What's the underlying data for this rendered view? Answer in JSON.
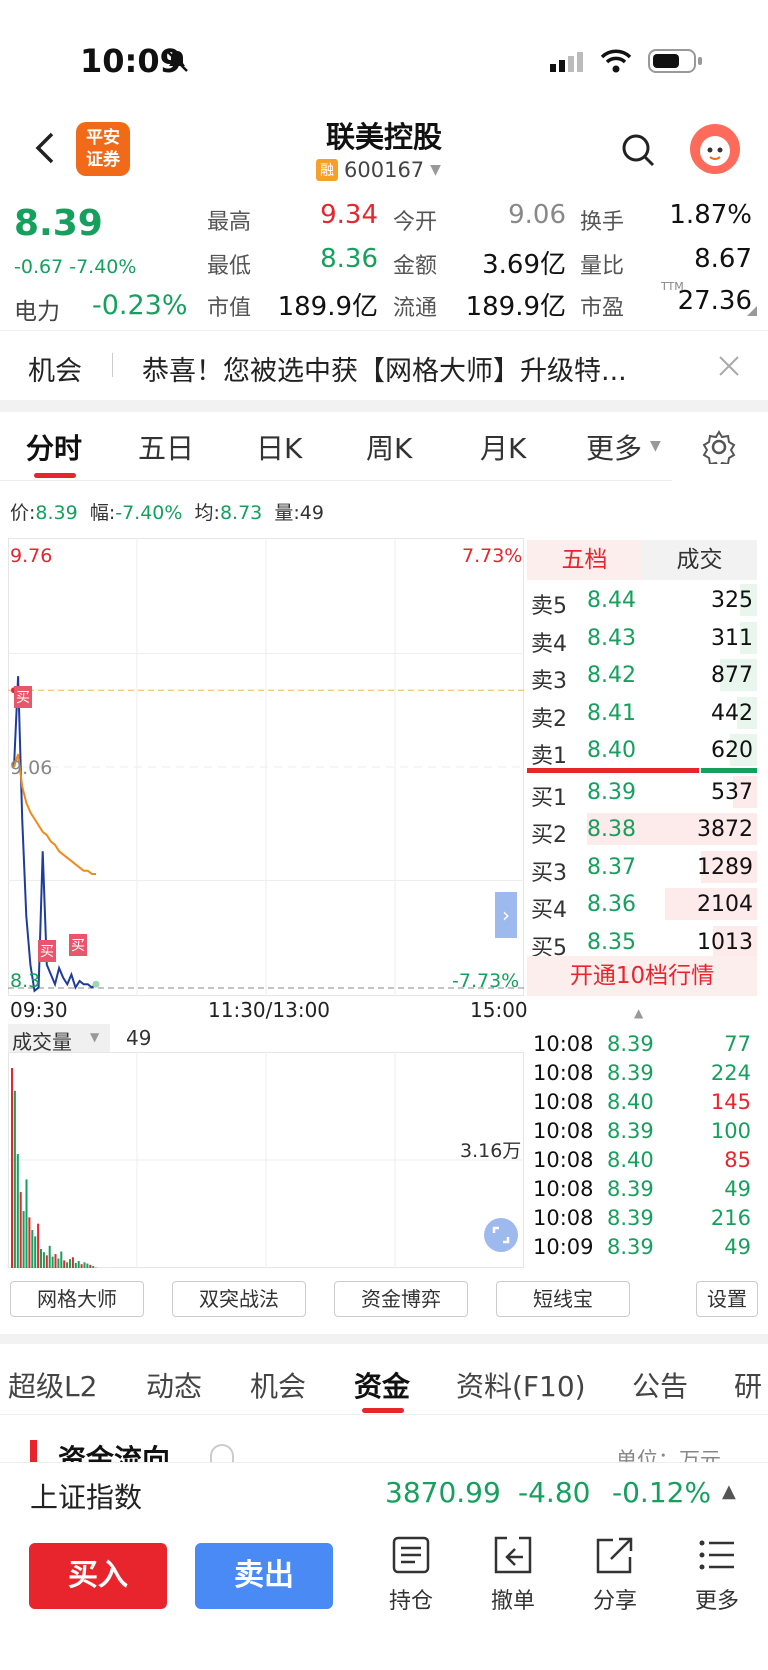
{
  "status": {
    "time": "10:09"
  },
  "header": {
    "title": "联美控股",
    "rong": "融",
    "code": "600167",
    "logo_line1": "平安",
    "logo_line2": "证券"
  },
  "quote": {
    "price": "8.39",
    "change": "-0.67",
    "change_pct": "-7.40%",
    "sector_label": "电力",
    "sector_value": "-0.23%",
    "fields": [
      {
        "label": "最高",
        "value": "9.34",
        "color": "red"
      },
      {
        "label": "今开",
        "value": "9.06",
        "color": "gray"
      },
      {
        "label": "换手",
        "value": "1.87%",
        "color": "dark"
      },
      {
        "label": "最低",
        "value": "8.36",
        "color": "green"
      },
      {
        "label": "金额",
        "value": "3.69亿",
        "color": "dark"
      },
      {
        "label": "量比",
        "value": "8.67",
        "color": "dark"
      },
      {
        "label": "市值",
        "value": "189.9亿",
        "color": "dark"
      },
      {
        "label": "流通",
        "value": "189.9亿",
        "color": "dark"
      },
      {
        "label": "市盈",
        "value": "27.36",
        "color": "dark"
      }
    ],
    "ttm": "TTM"
  },
  "notice": {
    "tag": "机会",
    "text": "恭喜！您被选中获【网格大师】升级特..."
  },
  "chart_tabs": [
    "分时",
    "五日",
    "日K",
    "周K",
    "月K",
    "更多"
  ],
  "info": {
    "price_label": "价:",
    "price": "8.39",
    "amp_label": "幅:",
    "amp": "-7.40%",
    "avg_label": "均:",
    "avg": "8.73",
    "vol_label": "量:",
    "vol": "49"
  },
  "chart_labels": {
    "top_price": "9.76",
    "top_pct": "7.73%",
    "mid_price": "9.06",
    "bottom_price": "8.3",
    "bottom_pct": "-7.73%",
    "t_start": "09:30",
    "t_mid": "11:30/13:00",
    "t_end": "15:00",
    "vol_title": "成交量",
    "vol_value": "49",
    "vol_max": "3.16万",
    "marker": "买"
  },
  "chart_data": {
    "type": "line",
    "ylim": [
      8.36,
      9.76
    ],
    "prev_close": 9.06,
    "series": [
      {
        "name": "价",
        "values": [
          9.06,
          9.34,
          8.9,
          8.6,
          8.45,
          8.37,
          8.38,
          8.8,
          8.45,
          8.42,
          8.39,
          8.44,
          8.41,
          8.39,
          8.42,
          8.38,
          8.4,
          8.39,
          8.39,
          8.38,
          8.39
        ]
      },
      {
        "name": "均",
        "values": [
          9.06,
          9.1,
          9.0,
          8.95,
          8.92,
          8.9,
          8.88,
          8.86,
          8.85,
          8.83,
          8.82,
          8.8,
          8.79,
          8.78,
          8.77,
          8.76,
          8.75,
          8.74,
          8.74,
          8.73,
          8.73
        ]
      }
    ],
    "volume": [
      31600,
      28000,
      18000,
      12000,
      9000,
      14000,
      8000,
      6000,
      5000,
      7000,
      3000,
      2500,
      2000,
      3500,
      1800,
      2200,
      1500,
      2600,
      1200,
      900,
      1400,
      1700,
      800,
      1100,
      600,
      900,
      700,
      500,
      300,
      49
    ]
  },
  "orderbook": {
    "tabs": [
      "五档",
      "成交"
    ],
    "asks": [
      {
        "label": "卖5",
        "price": "8.44",
        "qty": "325",
        "level": 0.1
      },
      {
        "label": "卖4",
        "price": "8.43",
        "qty": "311",
        "level": 0.1
      },
      {
        "label": "卖3",
        "price": "8.42",
        "qty": "877",
        "level": 0.22
      },
      {
        "label": "卖2",
        "price": "8.41",
        "qty": "442",
        "level": 0.12
      },
      {
        "label": "卖1",
        "price": "8.40",
        "qty": "620",
        "level": 0.16
      }
    ],
    "bids": [
      {
        "label": "买1",
        "price": "8.39",
        "qty": "537",
        "level": 0.14
      },
      {
        "label": "买2",
        "price": "8.38",
        "qty": "3872",
        "level": 1.0
      },
      {
        "label": "买3",
        "price": "8.37",
        "qty": "1289",
        "level": 0.33
      },
      {
        "label": "买4",
        "price": "8.36",
        "qty": "2104",
        "level": 0.54
      },
      {
        "label": "买5",
        "price": "8.35",
        "qty": "1013",
        "level": 0.26
      }
    ],
    "upgrade": "开通10档行情",
    "ticks": [
      {
        "time": "10:08",
        "price": "8.39",
        "qty": "77",
        "dir": "down"
      },
      {
        "time": "10:08",
        "price": "8.39",
        "qty": "224",
        "dir": "down"
      },
      {
        "time": "10:08",
        "price": "8.40",
        "qty": "145",
        "dir": "up"
      },
      {
        "time": "10:08",
        "price": "8.39",
        "qty": "100",
        "dir": "down"
      },
      {
        "time": "10:08",
        "price": "8.40",
        "qty": "85",
        "dir": "up"
      },
      {
        "time": "10:08",
        "price": "8.39",
        "qty": "49",
        "dir": "down"
      },
      {
        "time": "10:08",
        "price": "8.39",
        "qty": "216",
        "dir": "down"
      },
      {
        "time": "10:09",
        "price": "8.39",
        "qty": "49",
        "dir": "down"
      }
    ]
  },
  "tools": [
    "网格大师",
    "双突战法",
    "资金博弈",
    "短线宝",
    "设置"
  ],
  "bottom_tabs": [
    "超级L2",
    "动态",
    "机会",
    "资金",
    "资料(F10)",
    "公告",
    "研"
  ],
  "section": {
    "title": "资金流向",
    "unit": "单位：万元"
  },
  "index_bar": {
    "name": "上证指数",
    "value": "3870.99",
    "change": "-4.80",
    "pct": "-0.12%"
  },
  "actions": {
    "buy": "买入",
    "sell": "卖出",
    "items": [
      "持仓",
      "撤单",
      "分享",
      "更多"
    ]
  },
  "colors": {
    "red": "#e8242c",
    "green": "#16a05d",
    "blue": "#4a8af4",
    "orange": "#f06a1a"
  }
}
